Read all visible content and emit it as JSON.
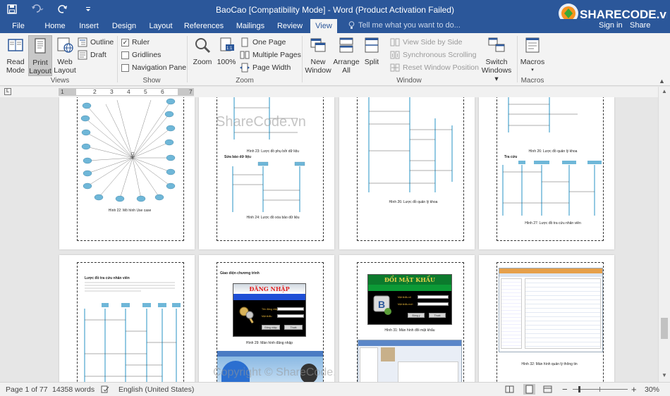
{
  "window": {
    "title": "BaoCao [Compatibility Mode] - Word (Product Activation Failed)",
    "logo_text": "SHARECODE.vn"
  },
  "qat": {
    "save_icon": "save-icon",
    "undo_icon": "undo-icon",
    "redo_icon": "redo-icon",
    "customize_icon": "customize-qat-icon"
  },
  "tabs": [
    {
      "label": "File"
    },
    {
      "label": "Home"
    },
    {
      "label": "Insert"
    },
    {
      "label": "Design"
    },
    {
      "label": "Layout"
    },
    {
      "label": "References"
    },
    {
      "label": "Mailings"
    },
    {
      "label": "Review"
    },
    {
      "label": "View"
    }
  ],
  "tellme": {
    "placeholder": "Tell me what you want to do..."
  },
  "account": {
    "signin": "Sign in",
    "share": "Share"
  },
  "ribbon": {
    "views": {
      "label": "Views",
      "read_mode": [
        "Read",
        "Mode"
      ],
      "print_layout": [
        "Print",
        "Layout"
      ],
      "web_layout": [
        "Web",
        "Layout"
      ],
      "outline": "Outline",
      "draft": "Draft"
    },
    "show": {
      "label": "Show",
      "ruler": "Ruler",
      "gridlines": "Gridlines",
      "navigation_pane": "Navigation Pane"
    },
    "zoom": {
      "label": "Zoom",
      "zoom": "Zoom",
      "hundred": "100%",
      "one_page": "One Page",
      "multiple_pages": "Multiple Pages",
      "page_width": "Page Width"
    },
    "window": {
      "label": "Window",
      "new_window": [
        "New",
        "Window"
      ],
      "arrange_all": [
        "Arrange",
        "All"
      ],
      "split": "Split",
      "view_side": "View Side by Side",
      "sync_scroll": "Synchronous Scrolling",
      "reset_pos": "Reset Window Position",
      "switch_windows": [
        "Switch",
        "Windows ▾"
      ]
    },
    "macros": {
      "label": "Macros",
      "macros": "Macros"
    }
  },
  "ruler": {
    "ticks": [
      "1",
      "2",
      "3",
      "4",
      "5",
      "6",
      "7"
    ]
  },
  "pages": {
    "captions": {
      "p1": "Hình 22: Mô hình Use case",
      "p2a": "Hình 23: Lược đồ phụ bởi dữ liệu",
      "p2b": "Hình 24: Lược đồ xóa bảo dữ liệu",
      "p3": "Hình 26: Lược đồ quản lý khoa",
      "p4": "Hình 27: Lược đồ tra cứu nhân viên",
      "p6": "Hình 29: Màn hình đăng nhập",
      "p7": "Hình 31: Màn hình đổi mật khẩu",
      "p8": "Hình 32: Màn hình quản lý thông tin"
    },
    "p2_heading": "Sửa bảo dữ liệu",
    "p4_heading": "Tra cứu",
    "p5_heading": "Lược đồ tra cứu nhân viên",
    "p6_heading": "Giao diện chương trình",
    "login": {
      "title": "ĐĂNG NHẬP",
      "user": "Tên đăng nhập",
      "pass": "Mật khẩu",
      "ok": "Đăng nhập",
      "cancel": "Thoát"
    },
    "changepw": {
      "title": "ĐỔI MẬT KHẨU",
      "old": "Mật khẩu cũ",
      "new": "Mật khẩu mới",
      "ok": "Đồng ý",
      "cancel": "Thoát"
    },
    "watermark": "ShareCode.vn",
    "copyright": "Copyright © ShareCode.vn"
  },
  "status": {
    "page": "Page 1 of 77",
    "words": "14358 words",
    "language": "English (United States)",
    "zoom": "30%",
    "zoom_value": 30
  }
}
